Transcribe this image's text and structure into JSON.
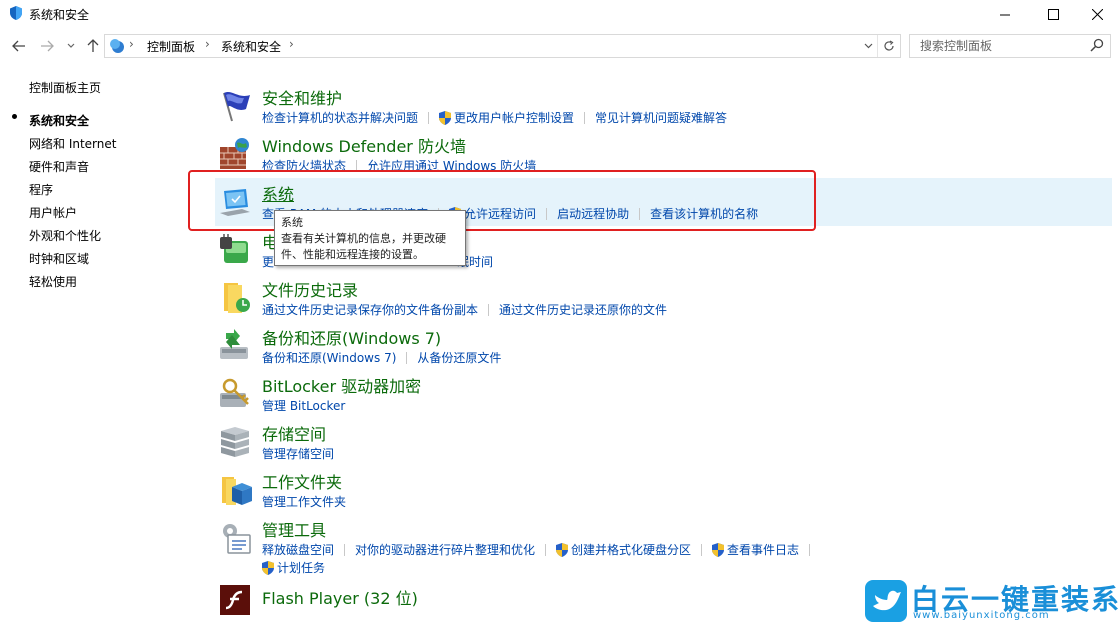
{
  "window": {
    "title": "系统和安全",
    "minimize_icon": "minimize-icon",
    "maximize_icon": "maximize-icon",
    "close_icon": "close-icon"
  },
  "address_bar": {
    "breadcrumbs": [
      "控制面板",
      "系统和安全"
    ],
    "search_placeholder": "搜索控制面板"
  },
  "sidebar": {
    "home": "控制面板主页",
    "items": [
      {
        "label": "系统和安全",
        "active": true
      },
      {
        "label": "网络和 Internet"
      },
      {
        "label": "硬件和声音"
      },
      {
        "label": "程序"
      },
      {
        "label": "用户帐户"
      },
      {
        "label": "外观和个性化"
      },
      {
        "label": "时钟和区域"
      },
      {
        "label": "轻松使用"
      }
    ]
  },
  "categories": {
    "security": {
      "title": "安全和维护",
      "links": [
        "检查计算机的状态并解决问题",
        "更改用户帐户控制设置",
        "常见计算机问题疑难解答"
      ]
    },
    "firewall": {
      "title": "Windows Defender 防火墙",
      "links": [
        "检查防火墙状态",
        "允许应用通过 Windows 防火墙"
      ]
    },
    "system": {
      "title": "系统",
      "links": [
        "查看 RAM 的大小和处理器速度",
        "允许远程访问",
        "启动远程协助",
        "查看该计算机的名称"
      ]
    },
    "power": {
      "title_partial": "电",
      "links_partial": [
        "更",
        "眠时间"
      ]
    },
    "file_history": {
      "title": "文件历史记录",
      "links": [
        "通过文件历史记录保存你的文件备份副本",
        "通过文件历史记录还原你的文件"
      ]
    },
    "backup": {
      "title": "备份和还原(Windows 7)",
      "links": [
        "备份和还原(Windows 7)",
        "从备份还原文件"
      ]
    },
    "bitlocker": {
      "title": "BitLocker 驱动器加密",
      "links": [
        "管理 BitLocker"
      ]
    },
    "storage": {
      "title": "存储空间",
      "links": [
        "管理存储空间"
      ]
    },
    "work_folders": {
      "title": "工作文件夹",
      "links": [
        "管理工作文件夹"
      ]
    },
    "admin_tools": {
      "title": "管理工具",
      "links": [
        "释放磁盘空间",
        "对你的驱动器进行碎片整理和优化",
        "创建并格式化硬盘分区",
        "查看事件日志",
        "计划任务"
      ]
    },
    "flash": {
      "title": "Flash Player (32 位)"
    }
  },
  "tooltip": {
    "title": "系统",
    "description": "查看有关计算机的信息，并更改硬件、性能和远程连接的设置。"
  },
  "watermark": {
    "name": "白云一键重装系统",
    "url": "www.baiyunxitong.com"
  },
  "colors": {
    "link": "#0047ab",
    "category_title": "#0b6a0b",
    "hover_row": "#e5f3fb",
    "highlight_box": "#e02020",
    "watermark": "#1a8fd8"
  }
}
